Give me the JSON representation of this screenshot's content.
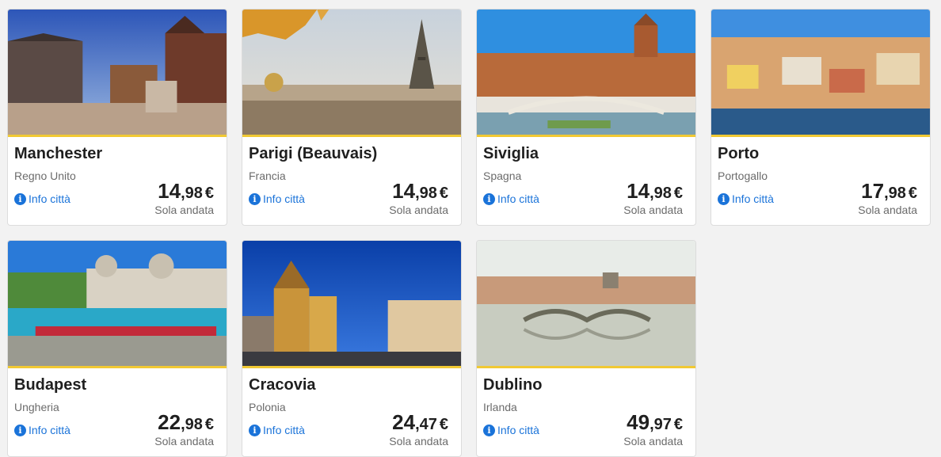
{
  "destinations": [
    {
      "city": "Manchester",
      "country": "Regno Unito",
      "info_label": "Info città",
      "price_int": "14",
      "price_dec": ",98",
      "currency": "€",
      "fare_type": "Sola andata"
    },
    {
      "city": "Parigi (Beauvais)",
      "country": "Francia",
      "info_label": "Info città",
      "price_int": "14",
      "price_dec": ",98",
      "currency": "€",
      "fare_type": "Sola andata"
    },
    {
      "city": "Siviglia",
      "country": "Spagna",
      "info_label": "Info città",
      "price_int": "14",
      "price_dec": ",98",
      "currency": "€",
      "fare_type": "Sola andata"
    },
    {
      "city": "Porto",
      "country": "Portogallo",
      "info_label": "Info città",
      "price_int": "17",
      "price_dec": ",98",
      "currency": "€",
      "fare_type": "Sola andata"
    },
    {
      "city": "Budapest",
      "country": "Ungheria",
      "info_label": "Info città",
      "price_int": "22",
      "price_dec": ",98",
      "currency": "€",
      "fare_type": "Sola andata"
    },
    {
      "city": "Cracovia",
      "country": "Polonia",
      "info_label": "Info città",
      "price_int": "24",
      "price_dec": ",47",
      "currency": "€",
      "fare_type": "Sola andata"
    },
    {
      "city": "Dublino",
      "country": "Irlanda",
      "info_label": "Info città",
      "price_int": "49",
      "price_dec": ",97",
      "currency": "€",
      "fare_type": "Sola andata"
    }
  ],
  "colors": {
    "accent_underline": "#f1c933",
    "link": "#1a73d9",
    "background": "#f2f2f2"
  }
}
